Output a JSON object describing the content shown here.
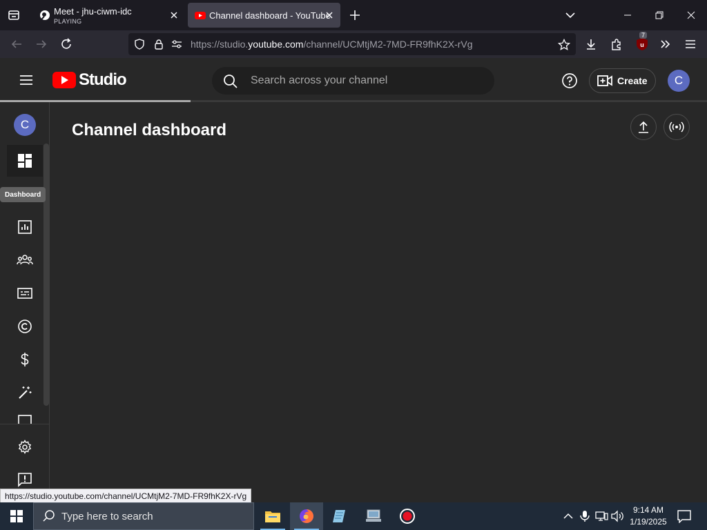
{
  "browser": {
    "tabs": [
      {
        "title": "Meet - jhu-ciwm-idc",
        "subtitle": "PLAYING",
        "active": false
      },
      {
        "title": "Channel dashboard - YouTube",
        "active": true
      }
    ],
    "url": {
      "prefix": "https://studio.",
      "domain": "youtube.com",
      "path": "/channel/UCMtjM2-7MD-FR9fhK2X-rVg"
    },
    "extension_badge": "7"
  },
  "studio": {
    "logo_text": "Studio",
    "search_placeholder": "Search across your channel",
    "create_label": "Create",
    "avatar_letter": "C",
    "page_title": "Channel dashboard",
    "load_progress": 0.27,
    "sidebar": {
      "avatar_letter": "C",
      "tooltip": "Dashboard",
      "items": [
        {
          "name": "dashboard",
          "icon": "dashboard-icon",
          "active": true
        },
        {
          "name": "analytics",
          "icon": "analytics-icon"
        },
        {
          "name": "community",
          "icon": "community-icon"
        },
        {
          "name": "subtitles",
          "icon": "subtitles-icon"
        },
        {
          "name": "copyright",
          "icon": "copyright-icon"
        },
        {
          "name": "earn",
          "icon": "dollar-icon"
        },
        {
          "name": "customization",
          "icon": "magic-wand-icon"
        },
        {
          "name": "settings",
          "icon": "gear-icon"
        },
        {
          "name": "send-feedback",
          "icon": "feedback-icon"
        }
      ]
    }
  },
  "status_link": "https://studio.youtube.com/channel/UCMtjM2-7MD-FR9fhK2X-rVg",
  "taskbar": {
    "search_placeholder": "Type here to search",
    "time": "9:14 AM",
    "date": "1/19/2025",
    "apps": [
      "file-explorer",
      "firefox",
      "notepad-app",
      "remote-app",
      "recorder-app"
    ]
  },
  "colors": {
    "youtube_red": "#ff0000",
    "avatar": "#5c6bc0",
    "studio_bg": "#282828"
  }
}
